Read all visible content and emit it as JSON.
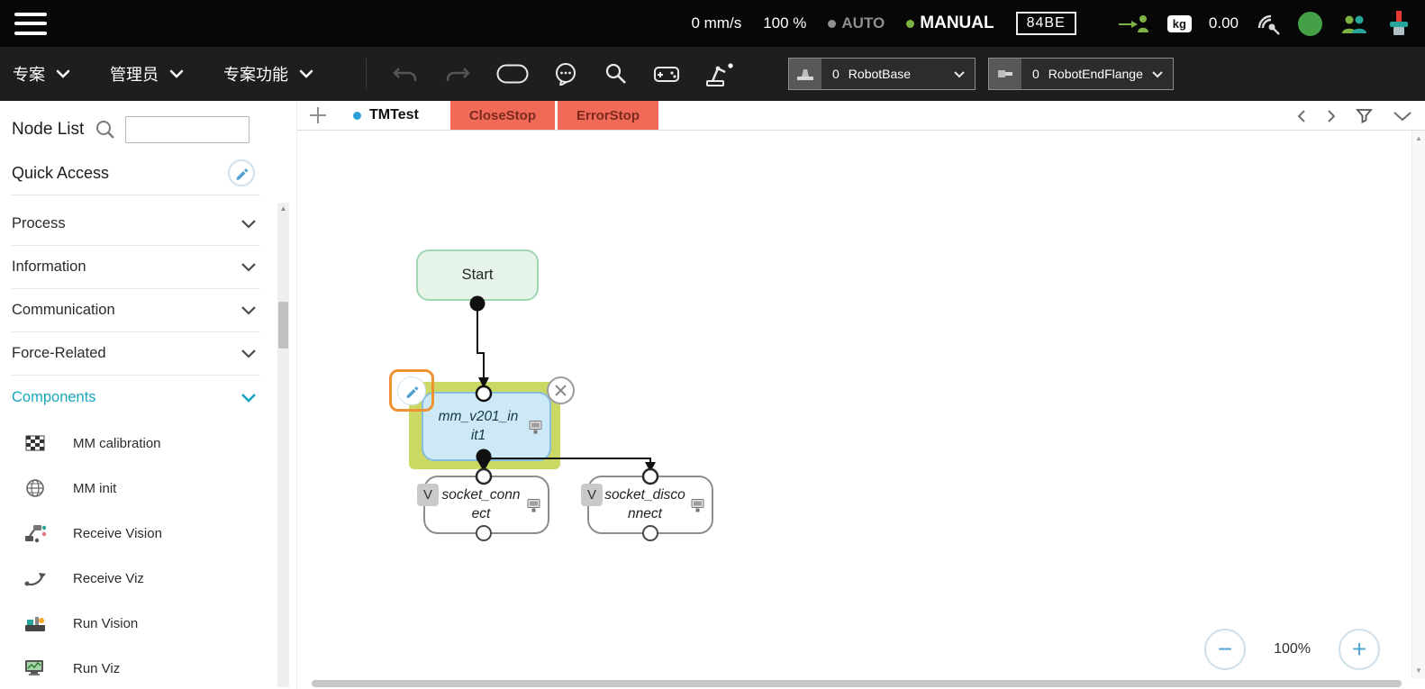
{
  "topbar": {
    "speed": "0 mm/s",
    "project_speed": "100 %",
    "auto_label": "AUTO",
    "manual_label": "MANUAL",
    "robot_id": "84BE",
    "payload_unit": "kg",
    "payload_value": "0.00"
  },
  "menubar": {
    "project": "专案",
    "account": "管理员",
    "project_function": "专案功能",
    "base": {
      "value": "0",
      "name": "RobotBase"
    },
    "tool": {
      "value": "0",
      "name": "RobotEndFlange"
    }
  },
  "sidebar": {
    "title": "Node List",
    "search_value": "",
    "quick_access": "Quick Access",
    "sections": [
      {
        "label": "Process"
      },
      {
        "label": "Information"
      },
      {
        "label": "Communication"
      },
      {
        "label": "Force-Related"
      },
      {
        "label": "Components"
      }
    ],
    "components": [
      {
        "label": "MM calibration"
      },
      {
        "label": "MM init"
      },
      {
        "label": "Receive Vision"
      },
      {
        "label": "Receive Viz"
      },
      {
        "label": "Run Vision"
      },
      {
        "label": "Run Viz"
      }
    ]
  },
  "tabs": [
    {
      "label": "TMTest"
    },
    {
      "label": "CloseStop"
    },
    {
      "label": "ErrorStop"
    }
  ],
  "flow": {
    "start_label": "Start",
    "mm_node_label": "mm_v201_init1",
    "socket_connect_label": "socket_connect",
    "socket_disconnect_label": "socket_disconnect",
    "variable_badge": "V"
  },
  "zoom": {
    "out": "−",
    "level": "100%",
    "in": "+"
  }
}
